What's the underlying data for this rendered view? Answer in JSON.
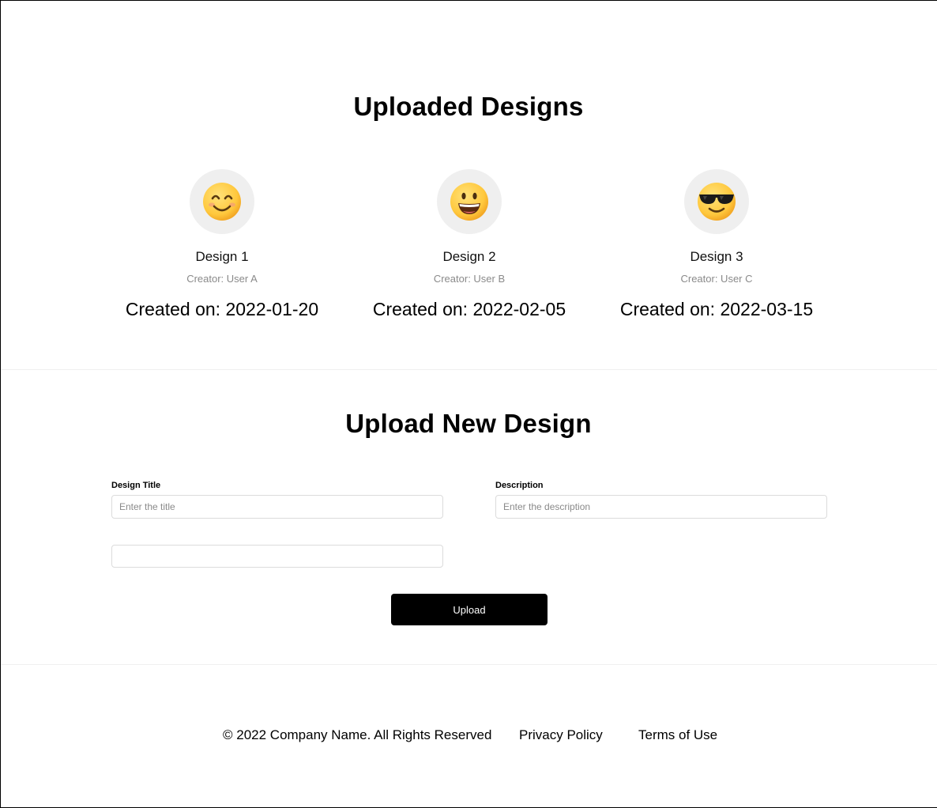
{
  "uploaded": {
    "title": "Uploaded Designs",
    "designs": [
      {
        "icon": "smiling-face-icon",
        "name": "Design 1",
        "creator": "Creator: User A",
        "date": "Created on: 2022-01-20"
      },
      {
        "icon": "grinning-face-icon",
        "name": "Design 2",
        "creator": "Creator: User B",
        "date": "Created on: 2022-02-05"
      },
      {
        "icon": "sunglasses-face-icon",
        "name": "Design 3",
        "creator": "Creator: User C",
        "date": "Created on: 2022-03-15"
      }
    ]
  },
  "upload_form": {
    "title": "Upload New Design",
    "title_label": "Design Title",
    "title_placeholder": "Enter the title",
    "title_value": "",
    "description_label": "Description",
    "description_placeholder": "Enter the description",
    "description_value": "",
    "file_value": "",
    "button_label": "Upload"
  },
  "footer": {
    "copyright": "© 2022 Company Name. All Rights Reserved",
    "links": [
      "Privacy Policy",
      "Terms of Use"
    ]
  },
  "colors": {
    "emoji_face": "#FFC83D",
    "thumb_bg": "#EFEFEF",
    "button_bg": "#000000",
    "muted_text": "#8A8A8A"
  }
}
